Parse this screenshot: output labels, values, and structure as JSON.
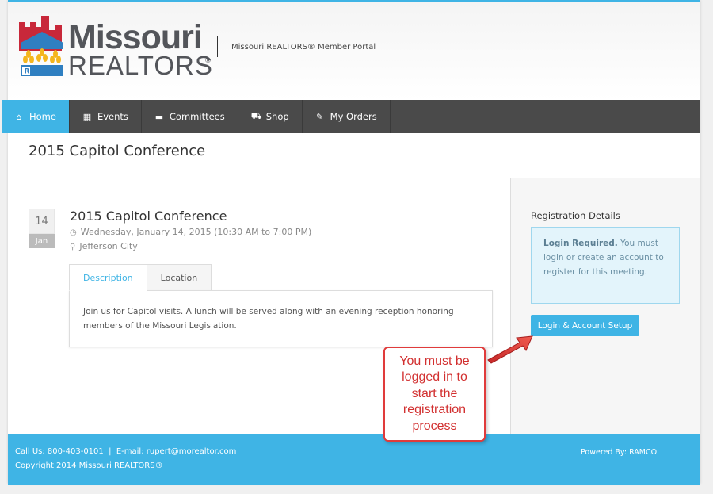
{
  "header": {
    "logo_word1": "Missouri",
    "logo_word2": "REALTORS",
    "logo_reg": "®",
    "portal_title": "Missouri REALTORS® Member Portal"
  },
  "nav": {
    "items": [
      {
        "label": "Home",
        "icon": "home-icon",
        "glyph": "⌂",
        "active": true
      },
      {
        "label": "Events",
        "icon": "calendar-icon",
        "glyph": "▦",
        "active": false
      },
      {
        "label": "Committees",
        "icon": "chat-icon",
        "glyph": "▬",
        "active": false
      },
      {
        "label": "Shop",
        "icon": "cart-icon",
        "glyph": "⛟",
        "active": false
      },
      {
        "label": "My Orders",
        "icon": "pin-icon",
        "glyph": "✎",
        "active": false
      }
    ]
  },
  "page": {
    "title": "2015 Capitol Conference"
  },
  "event": {
    "day": "14",
    "month": "Jan",
    "title": "2015 Capitol Conference",
    "datetime": "Wednesday, January 14, 2015 (10:30 AM to 7:00 PM)",
    "location": "Jefferson City",
    "tabs": [
      {
        "label": "Description",
        "active": true
      },
      {
        "label": "Location",
        "active": false
      }
    ],
    "description": "Join us for Capitol visits. A lunch will be served along with an evening reception honoring members of the Missouri Legislation."
  },
  "sidebar": {
    "title": "Registration Details",
    "alert_bold": "Login Required.",
    "alert_text": " You must login or create an account to register for this meeting.",
    "login_button": "Login & Account Setup"
  },
  "footer": {
    "line1": "Call Us: 800-403-0101  |  E-mail: rupert@morealtor.com",
    "line2": "Copyright 2014 Missouri REALTORS®",
    "powered": "Powered By: RAMCO"
  },
  "annotation": {
    "callout_text": "You must be logged in to start the registration process"
  },
  "colors": {
    "accent": "#3fb4e5",
    "nav_bg": "#4a4a4a",
    "callout_red": "#e03b3b"
  }
}
